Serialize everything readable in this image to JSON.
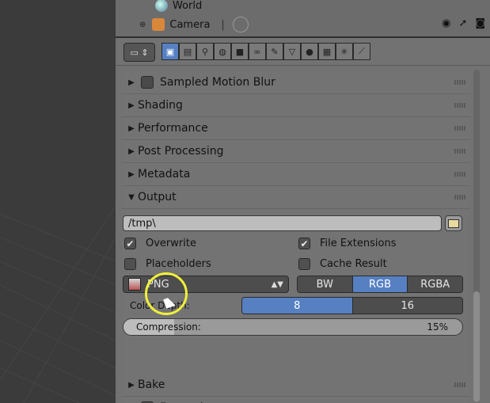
{
  "outliner": {
    "rows": [
      {
        "label": "World",
        "icon": "world-icon"
      },
      {
        "label": "Camera",
        "icon": "camera-object-icon"
      }
    ],
    "visibility_icons": [
      "eye-icon",
      "cursor-icon",
      "render-icon"
    ]
  },
  "props_header": {
    "editor_type_icon": "properties-editor-icon",
    "context_tabs": [
      {
        "name": "render",
        "glyph": "▣",
        "active": true
      },
      {
        "name": "render-layers",
        "glyph": "▤",
        "active": false
      },
      {
        "name": "scene",
        "glyph": "⚲",
        "active": false
      },
      {
        "name": "world",
        "glyph": "◍",
        "active": false
      },
      {
        "name": "object",
        "glyph": "■",
        "active": false
      },
      {
        "name": "constraints",
        "glyph": "∞",
        "active": false
      },
      {
        "name": "modifiers",
        "glyph": "✎",
        "active": false
      },
      {
        "name": "data",
        "glyph": "▽",
        "active": false
      },
      {
        "name": "material",
        "glyph": "●",
        "active": false
      },
      {
        "name": "texture",
        "glyph": "▦",
        "active": false
      },
      {
        "name": "particles",
        "glyph": "✳",
        "active": false
      },
      {
        "name": "physics",
        "glyph": "⟋",
        "active": false
      }
    ]
  },
  "sections_top": [
    {
      "label": "Sampled Motion Blur",
      "has_checkbox": true
    },
    {
      "label": "Shading",
      "has_checkbox": false
    },
    {
      "label": "Performance",
      "has_checkbox": false
    },
    {
      "label": "Post Processing",
      "has_checkbox": false
    },
    {
      "label": "Metadata",
      "has_checkbox": false
    }
  ],
  "output": {
    "label": "Output",
    "path": "/tmp\\",
    "overwrite": {
      "label": "Overwrite",
      "checked": true
    },
    "file_extensions": {
      "label": "File Extensions",
      "checked": true
    },
    "placeholders": {
      "label": "Placeholders",
      "checked": false
    },
    "cache_result": {
      "label": "Cache Result",
      "checked": false
    },
    "format": "PNG",
    "color_modes": [
      {
        "label": "BW",
        "selected": false
      },
      {
        "label": "RGB",
        "selected": true
      },
      {
        "label": "RGBA",
        "selected": false
      }
    ],
    "color_depth_label": "Color Depth:",
    "color_depths": [
      {
        "label": "8",
        "selected": true
      },
      {
        "label": "16",
        "selected": false
      }
    ],
    "compression_label": "Compression:",
    "compression_value": "15%",
    "compression_fraction": 0.15
  },
  "sections_bottom": [
    {
      "label": "Bake",
      "has_checkbox": false
    },
    {
      "label": "Freestyle",
      "has_checkbox": true
    }
  ],
  "colors": {
    "accent": "#5680c2",
    "cursor_highlight": "#f0f03a",
    "panel_bg": "#727272"
  }
}
